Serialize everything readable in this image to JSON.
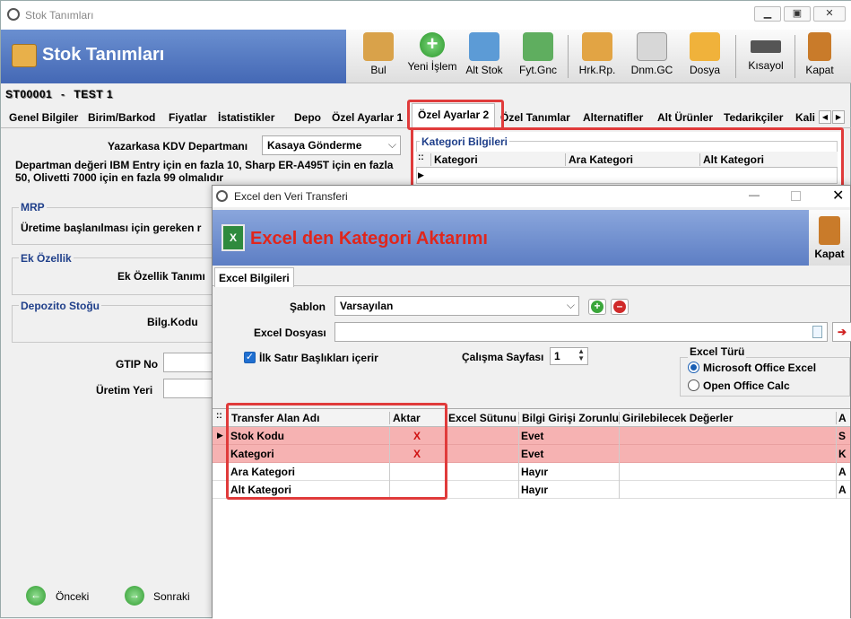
{
  "window": {
    "title": "Stok Tanımları"
  },
  "banner": {
    "title": "Stok Tanımları"
  },
  "toolbar": {
    "items": [
      {
        "label": "Bul"
      },
      {
        "label": "Yeni İşlem"
      },
      {
        "label": "Alt Stok"
      },
      {
        "label": "Fyt.Gnc"
      },
      {
        "label": "Hrk.Rp."
      },
      {
        "label": "Dnm.GC"
      },
      {
        "label": "Dosya"
      },
      {
        "label": "Kısayol"
      },
      {
        "label": "Kapat"
      }
    ]
  },
  "record": {
    "code": "ST00001",
    "sep": "-",
    "name": "TEST 1"
  },
  "tabs": [
    "Genel Bilgiler",
    "Birim/Barkod",
    "Fiyatlar",
    "İstatistikler",
    "Depo",
    "Özel Ayarlar 1",
    "Özel Ayarlar 2",
    "Özel Tanımlar",
    "Alternatifler",
    "Alt Ürünler",
    "Tedarikçiler",
    "Kali"
  ],
  "left": {
    "kdv_label": "Yazarkasa KDV Departmanı",
    "kdv_value": "Kasaya Gönderme",
    "kdv_note": "Departman değeri IBM Entry için en fazla 10, Sharp ER-A495T için en fazla 50, Olivetti 7000 için en fazla 99 olmalıdır",
    "mrp_title": "MRP",
    "mrp_label": "Üretime başlanılması için gereken r",
    "ek_title": "Ek Özellik",
    "ek_label": "Ek Özellik Tanımı",
    "depo_title": "Depozito Stoğu",
    "depo_label": "Bilg.Kodu",
    "gtip_label": "GTIP No",
    "uretim_label": "Üretim Yeri"
  },
  "kategori": {
    "title": "Kategori Bilgileri",
    "columns": [
      "Kategori",
      "Ara Kategori",
      "Alt Kategori"
    ]
  },
  "nav": {
    "prev": "Önceki",
    "next": "Sonraki"
  },
  "dialog": {
    "title": "Excel den Veri Transferi",
    "banner": "Excel den Kategori Aktarımı",
    "close_label": "Kapat",
    "tab": "Excel Bilgileri",
    "sablon_label": "Şablon",
    "sablon_value": "Varsayılan",
    "dosya_label": "Excel Dosyası",
    "dosya_value": "",
    "ilk_satir_label": "İlk Satır Başlıkları içerir",
    "ilk_satir_checked": true,
    "sayfa_label": "Çalışma Sayfası",
    "sayfa_value": "1",
    "excel_turu_title": "Excel Türü",
    "excel_turu_options": [
      "Microsoft Office Excel",
      "Open Office Calc"
    ],
    "excel_turu_selected": "Microsoft Office Excel",
    "grid": {
      "columns": [
        "Transfer Alan Adı",
        "Aktar",
        "Excel Sütunu",
        "Bilgi Girişi Zorunlu",
        "Girilebilecek Değerler",
        "A"
      ],
      "rows": [
        {
          "name": "Stok Kodu",
          "aktar": "X",
          "sutun": "",
          "zorunlu": "Evet",
          "degerler": "",
          "extra": "S"
        },
        {
          "name": "Kategori",
          "aktar": "X",
          "sutun": "",
          "zorunlu": "Evet",
          "degerler": "",
          "extra": "K"
        },
        {
          "name": "Ara Kategori",
          "aktar": "",
          "sutun": "",
          "zorunlu": "Hayır",
          "degerler": "",
          "extra": "A"
        },
        {
          "name": "Alt Kategori",
          "aktar": "",
          "sutun": "",
          "zorunlu": "Hayır",
          "degerler": "",
          "extra": "A"
        }
      ]
    }
  },
  "colors": {
    "banner": "#4468b5",
    "highlight": "#e03b3b",
    "required_row": "#f6b2b2",
    "dialog_title": "#e0261c"
  }
}
